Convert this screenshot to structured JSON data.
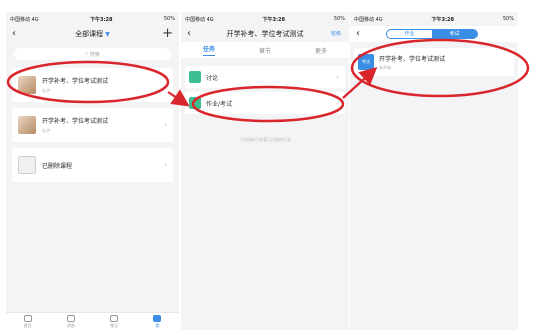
{
  "status": {
    "carrier": "中国移动 4G",
    "time": "下午3:28",
    "battery": "50%"
  },
  "panel1": {
    "nav_title": "全部课程",
    "search_placeholder": "搜索",
    "courses": [
      {
        "title": "开学补考、学位考试测试",
        "sub": "杜洪"
      },
      {
        "title": "开学补考、学位考试测试",
        "sub": "杜洪"
      },
      {
        "title": "已删除课程",
        "sub": ""
      }
    ],
    "tabs": [
      "首页",
      "消息",
      "笔记",
      "我"
    ]
  },
  "panel2": {
    "nav_title": "开学补考、学位考试测试",
    "nav_right": "班级",
    "tabs": [
      "任务",
      "章节",
      "更多"
    ],
    "rows": [
      "讨论",
      "作业/考试"
    ],
    "hint": "下拉刷新可查看已过期的任务"
  },
  "panel3": {
    "segments": [
      "作业",
      "考试"
    ],
    "exam_badge": "考试",
    "exam_title": "开学补考、学位考试测试",
    "exam_sub": "未开始"
  },
  "colors": {
    "accent": "#3a8ee6",
    "annotation": "#d9262c",
    "discussion": "#3bbf91"
  }
}
